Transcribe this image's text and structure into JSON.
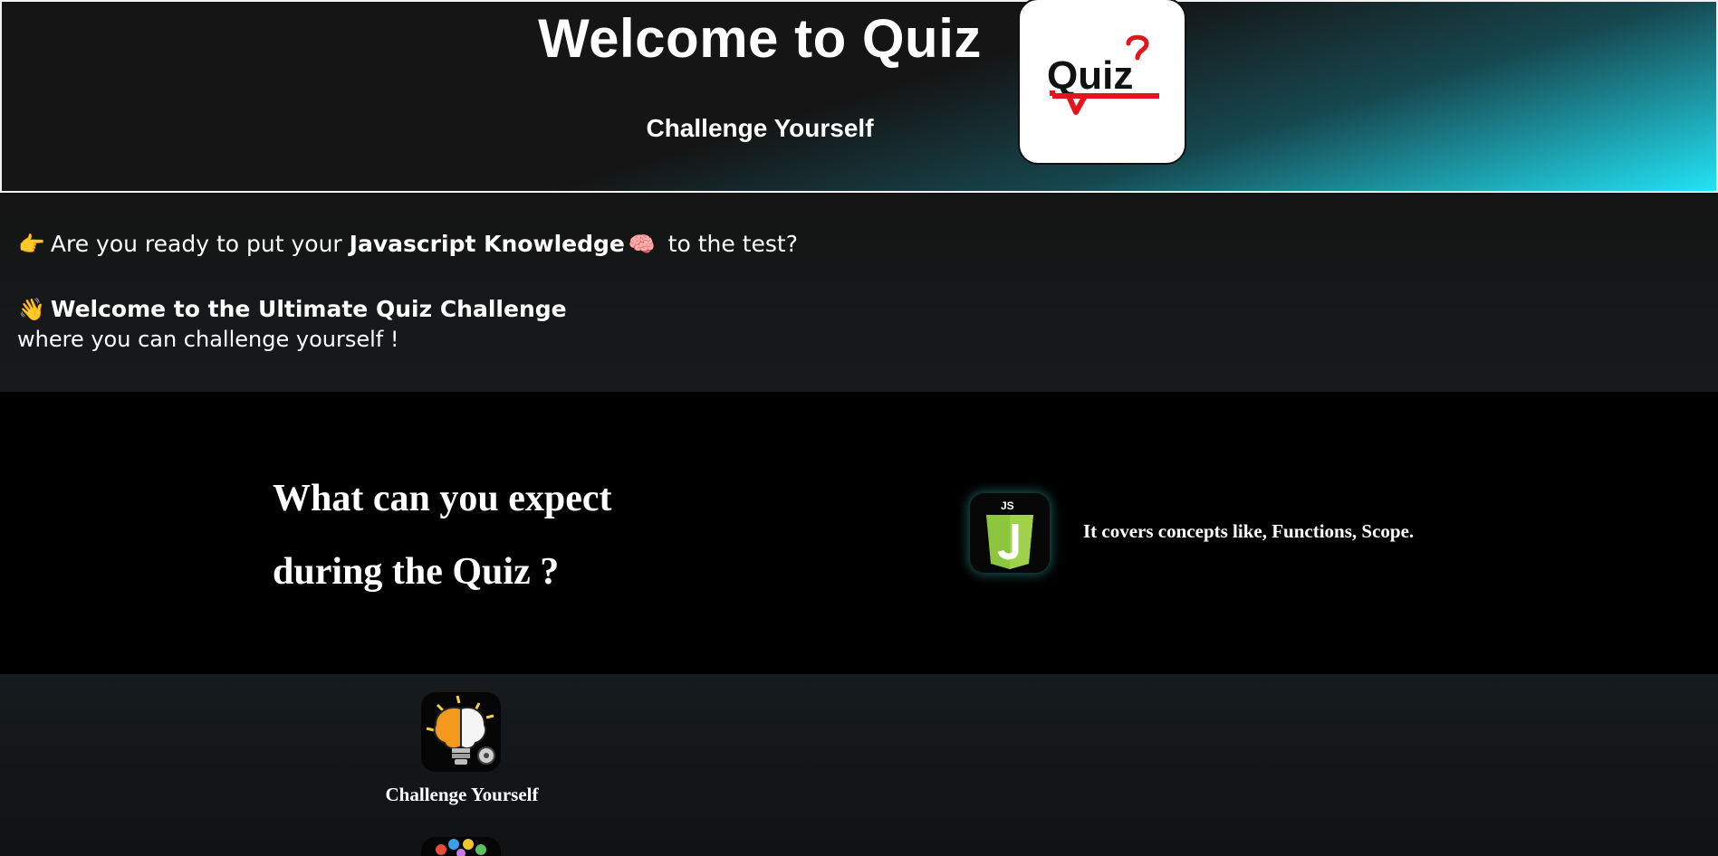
{
  "header": {
    "title": "Welcome to Quiz",
    "subtitle": "Challenge Yourself",
    "logo_text": "Quiz",
    "logo_icon": "quiz-speech-bubble-logo"
  },
  "intro": {
    "line1": {
      "icon": "pointing-hand-emoji",
      "prefix": "Are you ready to put your ",
      "bold": "Javascript Knowledge",
      "icon2": "brain-emoji",
      "suffix": " to the test?"
    },
    "line2": {
      "icon": "waving-hand-emoji",
      "bold": "Welcome to the Ultimate Quiz Challenge"
    },
    "line3": "where you can challenge yourself !"
  },
  "expect": {
    "title_line1": "What can you expect",
    "title_line2": "during the Quiz ?",
    "js_icon": "javascript-icon",
    "js_badge_text": "JS",
    "description": "It covers concepts like, Functions, Scope."
  },
  "cards": {
    "items": [
      {
        "label": "Challenge Yourself",
        "icon": "brain-lightbulb-icon"
      }
    ]
  },
  "colors": {
    "accent_cyan": "#22e3f5",
    "js_green": "#8cc63f",
    "logo_red": "#e3141b"
  }
}
